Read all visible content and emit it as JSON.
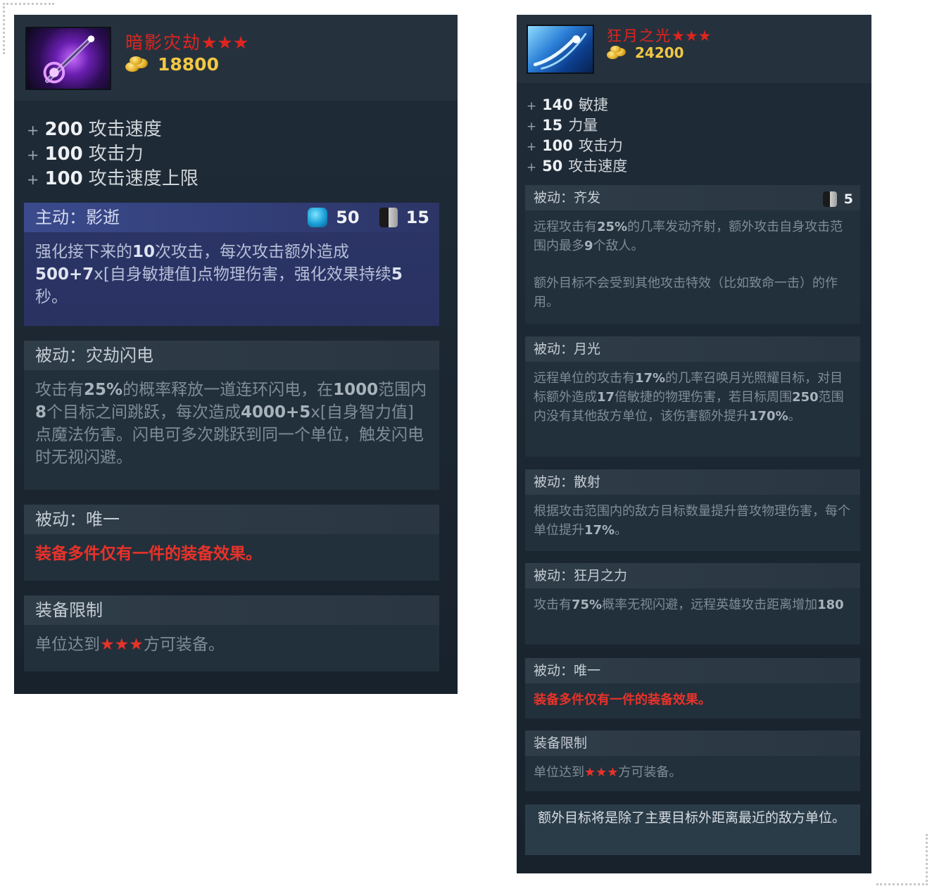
{
  "card1": {
    "title": "暗影灾劫",
    "title_stars": "★★★",
    "icon": "shadow-scepter-icon",
    "cost": "18800",
    "stats": [
      {
        "value": "200",
        "name": "攻击速度"
      },
      {
        "value": "100",
        "name": "攻击力"
      },
      {
        "value": "100",
        "name": "攻击速度上限"
      }
    ],
    "active": {
      "header": "主动：影逝",
      "mana": "50",
      "cooldown": "15",
      "text_parts": [
        {
          "t": "强化接下来的",
          "b": false
        },
        {
          "t": "10",
          "b": true
        },
        {
          "t": "次攻击，每次攻击额外造成",
          "b": false
        },
        {
          "t": "500",
          "b": true
        },
        {
          "t": "+7",
          "b": true
        },
        {
          "t": "x[自身敏捷值]点物理伤害，强化效果持续",
          "b": false
        },
        {
          "t": "5",
          "b": true
        },
        {
          "t": "秒。",
          "b": false
        }
      ]
    },
    "passive1": {
      "header": "被动：灾劫闪电",
      "text_parts": [
        {
          "t": "攻击有",
          "b": false
        },
        {
          "t": "25%",
          "b": true
        },
        {
          "t": "的概率释放一道连环闪电，在",
          "b": false
        },
        {
          "t": "1000",
          "b": true
        },
        {
          "t": "范围内",
          "b": false
        },
        {
          "t": "8",
          "b": true
        },
        {
          "t": "个目标之间跳跃，每次造成",
          "b": false
        },
        {
          "t": "4000+5",
          "b": true
        },
        {
          "t": "x[自身智力值]点魔法伤害。闪电可多次跳跃到同一个单位，触发闪电时无视闪避。",
          "b": false
        }
      ]
    },
    "passive2": {
      "header": "被动：唯一",
      "text": "装备多件仅有一件的装备效果。"
    },
    "restriction": {
      "header": "装备限制",
      "text_before": "单位达到",
      "stars": "★★★",
      "text_after": "方可装备。"
    }
  },
  "card2": {
    "title": "狂月之光",
    "title_stars": "★★★",
    "icon": "moon-glaive-icon",
    "cost": "24200",
    "stats": [
      {
        "value": "140",
        "name": "敏捷"
      },
      {
        "value": "15",
        "name": "力量"
      },
      {
        "value": "100",
        "name": "攻击力"
      },
      {
        "value": "50",
        "name": "攻击速度"
      }
    ],
    "passive_volley": {
      "header": "被动：齐发",
      "cooldown": "5",
      "text1_parts": [
        {
          "t": "远程攻击有",
          "b": false
        },
        {
          "t": "25%",
          "b": true
        },
        {
          "t": "的几率发动齐射，额外攻击自身攻击范围内最多",
          "b": false
        },
        {
          "t": "9",
          "b": true
        },
        {
          "t": "个敌人。",
          "b": false
        }
      ],
      "text2": "额外目标不会受到其他攻击特效（比如致命一击）的作用。"
    },
    "passive_moonlight": {
      "header": "被动：月光",
      "text_parts": [
        {
          "t": "远程单位的攻击有",
          "b": false
        },
        {
          "t": "17%",
          "b": true
        },
        {
          "t": "的几率召唤月光照耀目标，对目标额外造成",
          "b": false
        },
        {
          "t": "17",
          "b": true
        },
        {
          "t": "倍敏捷的物理伤害，若目标周围",
          "b": false
        },
        {
          "t": "250",
          "b": true
        },
        {
          "t": "范围内没有其他敌方单位，该伤害额外提升",
          "b": false
        },
        {
          "t": "170%",
          "b": true
        },
        {
          "t": "。",
          "b": false
        }
      ]
    },
    "passive_scatter": {
      "header": "被动：散射",
      "text_parts": [
        {
          "t": "根据攻击范围内的敌方目标数量提升普攻物理伤害，每个单位提升",
          "b": false
        },
        {
          "t": "17%",
          "b": true
        },
        {
          "t": "。",
          "b": false
        }
      ]
    },
    "passive_power": {
      "header": "被动：狂月之力",
      "text_parts": [
        {
          "t": "攻击有",
          "b": false
        },
        {
          "t": "75%",
          "b": true
        },
        {
          "t": "概率无视闪避，远程英雄攻击距离增加",
          "b": false
        },
        {
          "t": "180",
          "b": true
        }
      ]
    },
    "passive_unique": {
      "header": "被动：唯一",
      "text": "装备多件仅有一件的装备效果。"
    },
    "restriction": {
      "header": "装备限制",
      "text_before": "单位达到",
      "stars": "★★★",
      "text_after": "方可装备。"
    },
    "note": "额外目标将是除了主要目标外距离最近的敌方单位。"
  }
}
